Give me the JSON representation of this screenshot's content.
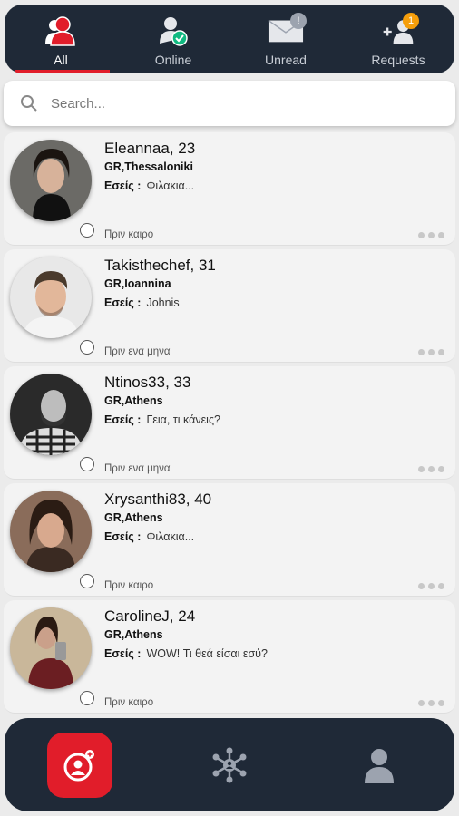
{
  "tabs": [
    {
      "label": "All",
      "icon": "users-icon",
      "active": true
    },
    {
      "label": "Online",
      "icon": "user-online-icon",
      "active": false
    },
    {
      "label": "Unread",
      "icon": "envelope-icon",
      "badge": "!",
      "active": false
    },
    {
      "label": "Requests",
      "icon": "add-user-icon",
      "badge": "1",
      "active": false
    }
  ],
  "search": {
    "placeholder": "Search..."
  },
  "conversations": [
    {
      "name": "Eleannaa, 23",
      "location": "GR,Thessaloniki",
      "sender": "Εσείς :",
      "message": "Φιλακια...",
      "time": "Πριν καιρο"
    },
    {
      "name": "Takisthechef, 31",
      "location": "GR,Ioannina",
      "sender": "Εσείς :",
      "message": "Johnis",
      "time": "Πριν ενα μηνα"
    },
    {
      "name": "Ntinos33, 33",
      "location": "GR,Athens",
      "sender": "Εσείς :",
      "message": "Γεια, τι κάνεις?",
      "time": "Πριν ενα μηνα"
    },
    {
      "name": "Xrysanthi83, 40",
      "location": "GR,Athens",
      "sender": "Εσείς :",
      "message": "Φιλακια...",
      "time": "Πριν καιρο"
    },
    {
      "name": "CarolineJ, 24",
      "location": "GR,Athens",
      "sender": "Εσείς :",
      "message": "WOW! Τι θεά είσαι εσύ?",
      "time": "Πριν καιρο"
    }
  ],
  "bottom_nav": [
    {
      "icon": "chat-user-icon",
      "active": true
    },
    {
      "icon": "network-icon",
      "active": false
    },
    {
      "icon": "profile-icon",
      "active": false
    }
  ],
  "colors": {
    "bar": "#1f2937",
    "accent": "#e11d2a",
    "badge_orange": "#f59e0b"
  }
}
